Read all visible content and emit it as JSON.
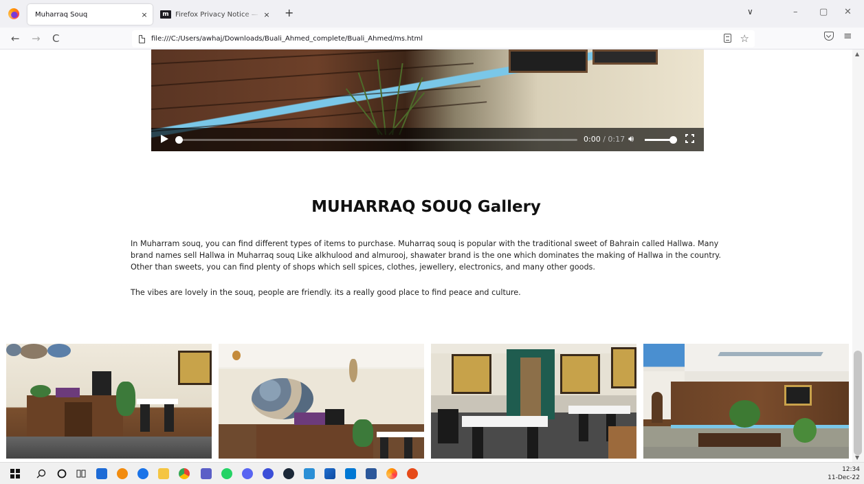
{
  "browser": {
    "tabs": [
      {
        "title": "Muharraq Souq",
        "active": true
      },
      {
        "title": "Firefox Privacy Notice — Mozill",
        "active": false,
        "favicon_text": "m"
      }
    ],
    "tab_close_glyph": "×",
    "new_tab_glyph": "+",
    "tab_list_glyph": "∨",
    "window_controls": [
      "–",
      "▢",
      "✕"
    ],
    "nav": {
      "back": "←",
      "forward": "→",
      "reload": "C",
      "menu": "≡",
      "bookmark_star": "☆"
    },
    "url": "file:///C:/Users/awhaj/Downloads/Buali_Ahmed_complete/Buali_Ahmed/ms.html",
    "icons": [
      "firefox-logo-icon",
      "page-icon",
      "reader-view-icon",
      "bookmark-star-icon",
      "pocket-icon",
      "hamburger-menu-icon"
    ]
  },
  "video_player": {
    "current_time": "0:00",
    "separator": " / ",
    "duration": "0:17",
    "progress": 0.0,
    "volume": 0.9,
    "icons": [
      "play-icon",
      "volume-icon",
      "fullscreen-icon"
    ]
  },
  "page": {
    "heading": "MUHARRAQ SOUQ Gallery",
    "paragraphs": [
      "In Muharram souq, you can find different types of items to purchase. Muharraq souq is popular with the traditional sweet of Bahrain called Hallwa. Many brand names sell Hallwa in Muharraq souq Like alkhulood and almurooj, shawater brand is the one which dominates the making of Hallwa in the country. Other than sweets, you can find plenty of shops which sell spices, clothes, jewellery, electronics, and many other goods.",
      "The vibes are lovely in the souq, people are friendly. its a really good place to find peace and culture."
    ],
    "gallery_count": 4
  },
  "scrollbar": {
    "up": "▲",
    "down": "▼"
  },
  "taskbar": {
    "icons": [
      "windows-start-icon",
      "search-icon",
      "cortana-icon",
      "task-view-icon",
      "store-icon",
      "search-app-icon",
      "github-icon",
      "file-explorer-icon",
      "chrome-icon",
      "teams-icon",
      "whatsapp-icon",
      "discord-icon",
      "iptv-icon",
      "steam-icon",
      "remote-icon",
      "photos-icon",
      "vscode-icon",
      "word-icon",
      "firefox-icon",
      "paint-icon"
    ],
    "colors": {
      "store": "#1e6bd6",
      "chrome": "#e84335",
      "teams": "#5b5fc7",
      "whatsapp": "#25d366",
      "discord": "#5865f2",
      "vscode": "#0078d4",
      "word": "#2b579a",
      "firefox": "#ff7139"
    },
    "time": "12:34",
    "date": "11-Dec-22"
  }
}
